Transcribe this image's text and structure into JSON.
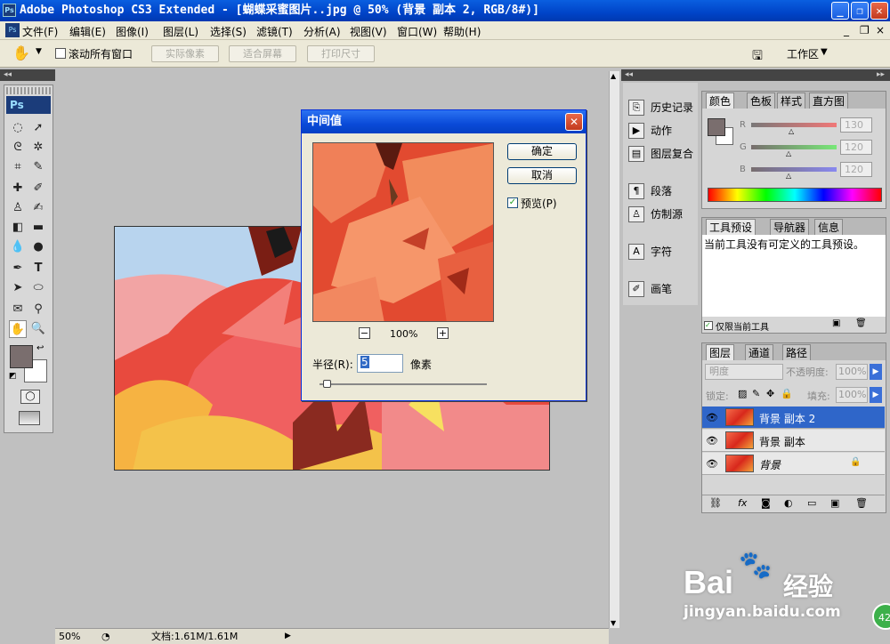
{
  "window": {
    "title": "Adobe Photoshop CS3 Extended - [蝴蝶采蜜图片..jpg @ 50% (背景 副本 2, RGB/8#)]",
    "ps_logo": "Ps",
    "min_glyph": "_",
    "max_glyph": "❐",
    "close_glyph": "✕"
  },
  "menubar": {
    "items": [
      "文件(F)",
      "编辑(E)",
      "图像(I)",
      "图层(L)",
      "选择(S)",
      "滤镜(T)",
      "分析(A)",
      "视图(V)",
      "窗口(W)",
      "帮助(H)"
    ],
    "right_controls": [
      "_",
      "❐",
      "×"
    ]
  },
  "options_bar": {
    "scroll_all_label": "滚动所有窗口",
    "actual_pixels": "实际像素",
    "fit_screen": "适合屏幕",
    "print_size": "打印尺寸",
    "workspace": "工作区"
  },
  "toolbox": {
    "logo": "Ps"
  },
  "dialog": {
    "title": "中间值",
    "ok": "确定",
    "cancel": "取消",
    "preview_label": "预览(P)",
    "preview_checked": true,
    "zoom": "100%",
    "radius_label": "半径(R):",
    "radius_value": "5",
    "radius_unit": "像素",
    "radius_slider_fraction": 0.02
  },
  "dock": {
    "items": [
      {
        "icon": "history-icon",
        "label": "历史记录"
      },
      {
        "icon": "actions-icon",
        "label": "动作"
      },
      {
        "icon": "layer-comps-icon",
        "label": "图层复合"
      },
      {
        "icon": "paragraph-icon",
        "label": "段落"
      },
      {
        "icon": "clone-source-icon",
        "label": "仿制源"
      },
      {
        "icon": "character-icon",
        "label": "字符"
      },
      {
        "icon": "brushes-icon",
        "label": "画笔"
      }
    ]
  },
  "color_panel": {
    "tabs": [
      "颜色",
      "色板",
      "样式",
      "直方图"
    ],
    "channels": [
      {
        "name": "R",
        "value": "130"
      },
      {
        "name": "G",
        "value": "120"
      },
      {
        "name": "B",
        "value": "120"
      }
    ]
  },
  "tool_presets_panel": {
    "tabs": [
      "工具预设",
      "导航器",
      "信息"
    ],
    "message": "当前工具没有可定义的工具预设。",
    "current_only_label": "仅限当前工具"
  },
  "layers_panel": {
    "tabs": [
      "图层",
      "通道",
      "路径"
    ],
    "blend_mode": "明度",
    "opacity_label": "不透明度:",
    "opacity_value": "100%",
    "lock_label": "锁定:",
    "fill_label": "填充:",
    "fill_value": "100%",
    "layers": [
      {
        "name": "背景 副本 2",
        "selected": true
      },
      {
        "name": "背景 副本",
        "selected": false
      },
      {
        "name": "背景",
        "selected": false,
        "locked": true
      }
    ]
  },
  "statusbar": {
    "zoom": "50%",
    "doc": "文档:1.61M/1.61M"
  },
  "watermark": {
    "brand": "Bai",
    "brand2": "经验",
    "url": "jingyan.baidu.com",
    "badge": "42"
  }
}
